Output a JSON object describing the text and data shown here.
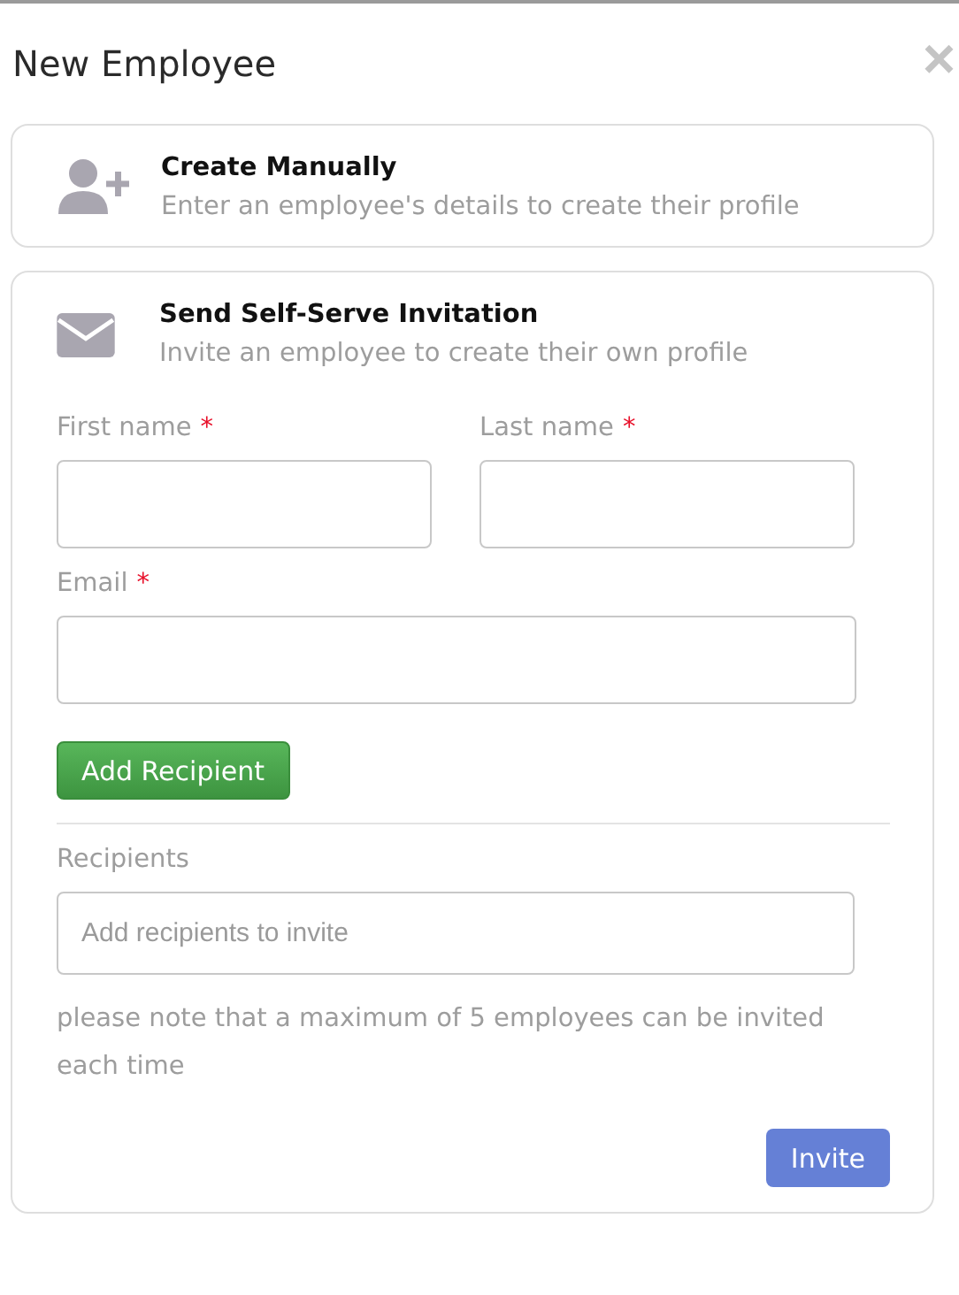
{
  "dialog": {
    "title": "New Employee",
    "close": "×"
  },
  "options": [
    {
      "kind": "person-add",
      "title": "Create Manually",
      "description": "Enter an employee's details to create their profile"
    },
    {
      "kind": "envelope",
      "title": "Send Self-Serve Invitation",
      "description": "Invite an employee to create their own profile"
    }
  ],
  "fields": [
    {
      "kind": "half",
      "label": "First name",
      "required_mark": "*"
    },
    {
      "kind": "half",
      "label": "Last name",
      "required_mark": "*"
    },
    {
      "kind": "full",
      "label": "Email",
      "required_mark": "*"
    }
  ],
  "add_button": "Add Recipient",
  "recipients": {
    "label": "Recipients",
    "placeholder": "Add recipients to invite",
    "note": "please note that a maximum of 5 employees can be invited each time"
  },
  "invite_button": "Invite"
}
